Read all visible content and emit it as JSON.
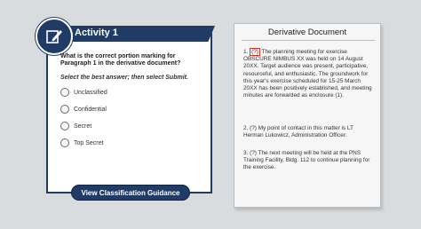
{
  "activity": {
    "title": "Activity 1",
    "question": "What is the correct portion marking for Paragraph 1 in the derivative document?",
    "instruction": "Select the best answer; then select Submit.",
    "options": [
      "Unclassified",
      "Confidential",
      "Secret",
      "Top Secret"
    ],
    "guidance_button": "View Classification Guidance",
    "badge_icon": "pencil-edit-icon"
  },
  "document": {
    "title": "Derivative Document",
    "paragraphs": [
      {
        "number": "1.",
        "marking": "(?)",
        "text": " The planning meeting for exercise OBSCURE NIMBUS XX was held on 14 August 20XX. Target audience was present, participative, resourceful, and enthusiastic. The groundwork for this year's exercise scheduled for 15-25 March 20XX has been positively established, and meeting minutes are forwarded as enclosure (1)."
      },
      {
        "number": "2.",
        "marking": "(?)",
        "text": " My point of contact in this matter is LT Herman Lukowicz, Administration Officer."
      },
      {
        "number": "3.",
        "marking": "(?)",
        "text": " The next meeting will be held at the PNS Training Facility, Bldg. 112 to continue planning for the exercise."
      }
    ]
  },
  "colors": {
    "navy": "#1f3b66",
    "highlight": "#d9342b",
    "background": "#d9dcde"
  }
}
